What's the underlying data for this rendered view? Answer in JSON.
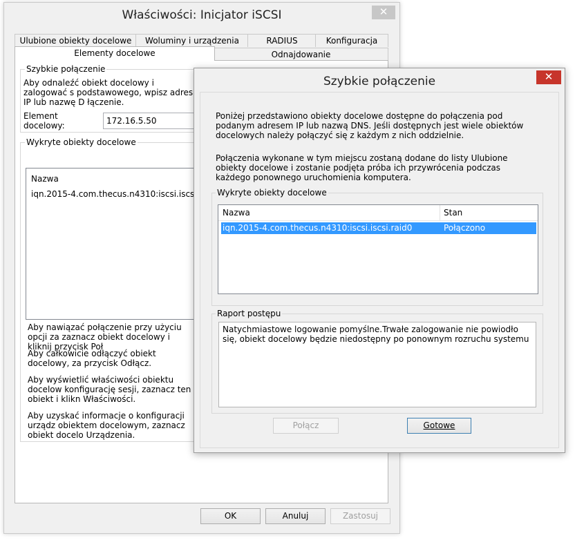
{
  "main": {
    "title": "Właściwości: Inicjator iSCSI",
    "close": "✕",
    "tabs_row1": [
      "Ulubione obiekty docelowe",
      "Woluminy i urządzenia",
      "RADIUS",
      "Konfiguracja"
    ],
    "tabs_row2": [
      "Elementy docelowe",
      "Odnajdowanie"
    ],
    "quick": {
      "legend": "Szybkie połączenie",
      "description": "Aby odnaleźć obiekt docelowy i zalogować s podstawowego, wpisz adres IP lub nazwę D łączenie.",
      "target_label": "Element docelowy:",
      "target_value": "172.16.5.50"
    },
    "discovered": {
      "legend": "Wykryte obiekty docelowe",
      "col_name": "Nazwa",
      "row": "iqn.2015-4.com.thecus.n4310:iscsi.iscsi.raid"
    },
    "help": [
      "Aby nawiązać połączenie przy użyciu opcji za zaznacz obiekt docelowy i kliknij przycisk Poł",
      "Aby całkowicie odłączyć obiekt docelowy, za przycisk Odłącz.",
      "Aby wyświetlić właściwości obiektu docelow konfigurację sesji, zaznacz ten obiekt i klikn Właściwości.",
      "Aby uzyskać informacje o konfiguracji urządz obiektem docelowym, zaznacz obiekt docelo Urządzenia."
    ],
    "buttons": {
      "ok": "OK",
      "cancel": "Anuluj",
      "apply": "Zastosuj"
    }
  },
  "dialog": {
    "title": "Szybkie połączenie",
    "close": "✕",
    "para1": "Poniżej przedstawiono obiekty docelowe dostępne do połączenia pod podanym adresem IP lub nazwą DNS. Jeśli dostępnych jest wiele obiektów docelowych należy połączyć się z każdym z nich oddzielnie.",
    "para2": "Połączenia wykonane w tym miejscu zostaną dodane do listy Ulubione obiekty docelowe i zostanie podjęta próba ich przywrócenia podczas każdego ponownego uruchomienia komputera.",
    "discovered_legend": "Wykryte obiekty docelowe",
    "columns": [
      "Nazwa",
      "Stan"
    ],
    "rows": [
      {
        "name": "iqn.2015-4.com.thecus.n4310:iscsi.iscsi.raid0",
        "status": "Połączono"
      }
    ],
    "progress_legend": "Raport postępu",
    "progress_text": "Natychmiastowe logowanie pomyślne.Trwałe zalogowanie nie powiodło się, obiekt docelowy będzie niedostępny po ponownym rozruchu systemu",
    "buttons": {
      "connect": "Połącz",
      "done": "Gotowe"
    }
  },
  "colors": {
    "close_red": "#c7352b",
    "selection": "#3399ff",
    "default_border": "#3c7fb1"
  }
}
